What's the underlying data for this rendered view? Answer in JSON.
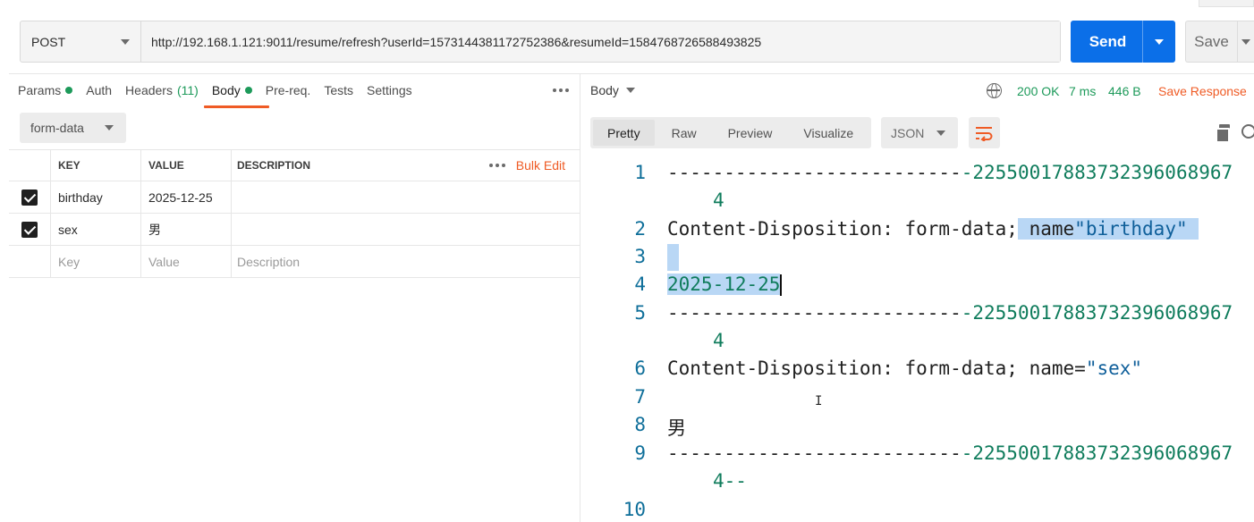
{
  "request": {
    "method": "POST",
    "url": "http://192.168.1.121:9011/resume/refresh?userId=1573144381172752386&resumeId=1584768726588493825",
    "send_label": "Send",
    "save_label": "Save"
  },
  "request_tabs": {
    "params": "Params",
    "auth": "Auth",
    "headers": "Headers",
    "headers_count": "(11)",
    "body": "Body",
    "prereq": "Pre-req.",
    "tests": "Tests",
    "settings": "Settings"
  },
  "body_type": "form-data",
  "params_table": {
    "headers": {
      "key": "KEY",
      "value": "VALUE",
      "description": "DESCRIPTION"
    },
    "bulk_edit": "Bulk Edit",
    "rows": [
      {
        "key": "birthday",
        "value": "2025-12-25",
        "description": "",
        "checked": true
      },
      {
        "key": "sex",
        "value": "男",
        "description": "",
        "checked": true
      }
    ],
    "placeholder": {
      "key": "Key",
      "value": "Value",
      "description": "Description"
    }
  },
  "response": {
    "body_label": "Body",
    "status": "200 OK",
    "time": "7 ms",
    "size": "446 B",
    "save_response": "Save Response",
    "view_tabs": [
      "Pretty",
      "Raw",
      "Preview",
      "Visualize"
    ],
    "active_view": "Pretty",
    "format": "JSON"
  },
  "code": {
    "line_numbers": [
      "1",
      "2",
      "3",
      "4",
      "5",
      "6",
      "7",
      "8",
      "9",
      "10"
    ],
    "dashes": "--------------------------",
    "boundary": "-2255001788373239606896",
    "boundary_tail": "7",
    "wrap_4": "4",
    "wrap_4_end": "4--",
    "cd_prefix": "Content-Disposition: form-data;",
    "name_key": "name",
    "name_eq": "name=",
    "birthday_str": "\"birthday\"",
    "sex_str": "\"sex\"",
    "birthday_value": "2025-12-25",
    "sex_value": "男"
  },
  "colors": {
    "accent_orange": "#ef5b25",
    "send_blue": "#0b6fe8",
    "status_green": "#1d9a5a",
    "selection": "#b9d7f5"
  }
}
